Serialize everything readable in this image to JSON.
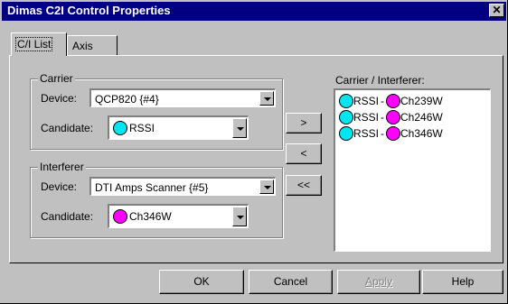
{
  "window": {
    "title": "Dimas C2I Control Properties",
    "close_glyph": "✕"
  },
  "tabs": [
    {
      "label": "C/I List",
      "active": true
    },
    {
      "label": "Axis",
      "active": false
    }
  ],
  "carrier": {
    "group_label": "Carrier",
    "device_label": "Device:",
    "device_value": "QCP820 {#4}",
    "candidate_label": "Candidate:",
    "candidate_value": "RSSI",
    "candidate_icon": "cyan-circle-icon"
  },
  "interferer": {
    "group_label": "Interferer",
    "device_label": "Device:",
    "device_value": "DTI Amps Scanner {#5}",
    "candidate_label": "Candidate:",
    "candidate_value": "Ch346W",
    "candidate_icon": "magenta-circle-icon"
  },
  "move_buttons": {
    "add": ">",
    "remove": "<",
    "remove_all": "<<"
  },
  "pairs_list": {
    "label": "Carrier / Interferer:",
    "separator": "-",
    "items": [
      {
        "carrier": "RSSI",
        "interferer": "Ch239W"
      },
      {
        "carrier": "RSSI",
        "interferer": "Ch246W"
      },
      {
        "carrier": "RSSI",
        "interferer": "Ch346W"
      }
    ]
  },
  "footer": {
    "ok": "OK",
    "cancel": "Cancel",
    "apply": "Apply",
    "help": "Help"
  },
  "colors": {
    "carrier_circle": "#00e5f0",
    "interferer_circle": "#ff00ff",
    "titlebar": "#000080",
    "face": "#c0c0c0"
  }
}
